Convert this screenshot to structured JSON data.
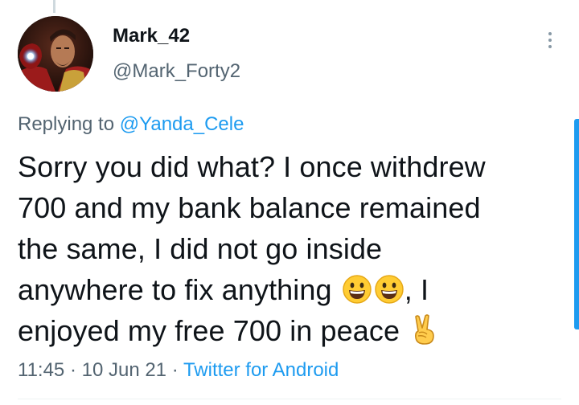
{
  "author": {
    "display_name": "Mark_42",
    "handle": "@Mark_Forty2",
    "avatar_icon": "iron-man-avatar"
  },
  "reply": {
    "prefix": "Replying to ",
    "mention": "@Yanda_Cele"
  },
  "tweet": {
    "lines": [
      "Sorry you did what? I once withdrew",
      "700 and my bank balance remained",
      "the same, I did not go inside",
      "anywhere to fix anything ",
      "enjoyed my free 700 in peace "
    ],
    "line4_suffix": ", I",
    "emojis": [
      "grinning-face",
      "grinning-face",
      "victory-hand"
    ]
  },
  "meta": {
    "time": "11:45",
    "sep1": " · ",
    "date": "10 Jun 21",
    "sep2": " · ",
    "source": "Twitter for Android"
  },
  "colors": {
    "link": "#1d9bf0",
    "secondary_text": "#536471",
    "primary_text": "#0f1419"
  }
}
